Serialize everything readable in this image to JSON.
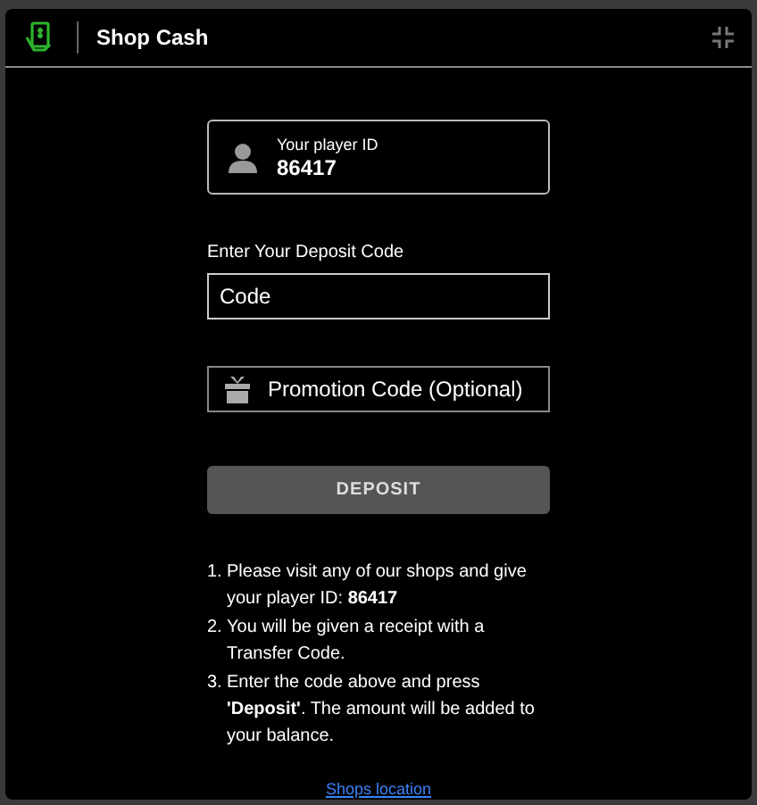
{
  "window": {
    "title": "Shop Cash"
  },
  "player": {
    "label": "Your player ID",
    "id": "86417"
  },
  "deposit_code": {
    "label": "Enter Your Deposit Code",
    "value": "Code"
  },
  "promotion": {
    "label": "Promotion Code (Optional)"
  },
  "deposit_button": {
    "label": "DEPOSIT",
    "disabled": true
  },
  "instructions": [
    {
      "number": "1.",
      "text": "Please visit any of our shops and give your player ID: **86417**"
    },
    {
      "number": "2.",
      "text": "You will be given a receipt with a Transfer Code."
    },
    {
      "number": "3.",
      "text": "Enter the code above and press **'Deposit'**. The amount will be added to your balance."
    }
  ],
  "link": "Shops location"
}
